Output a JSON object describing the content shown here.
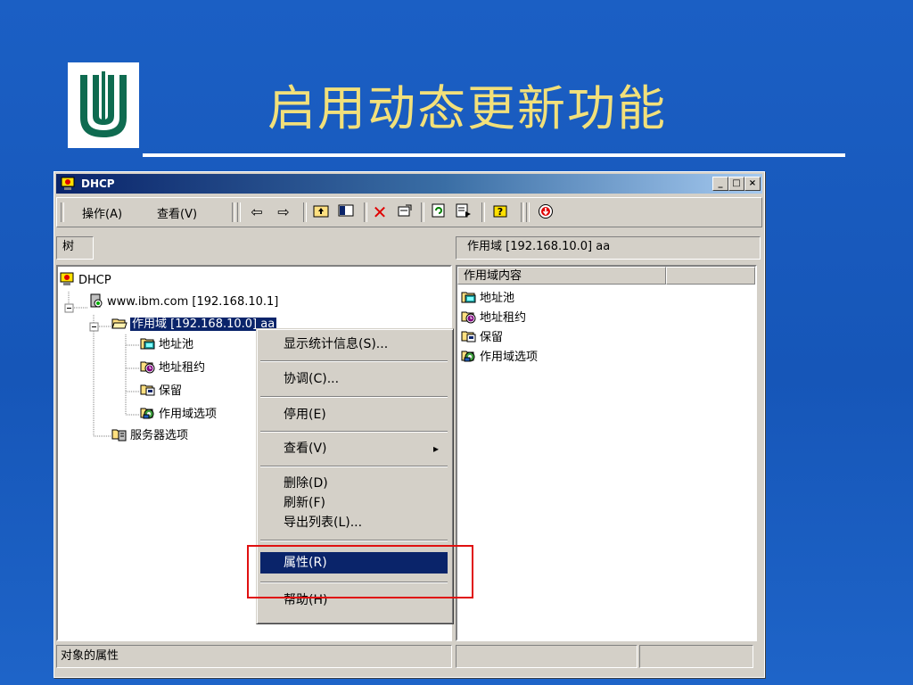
{
  "slide": {
    "title": "启用动态更新功能"
  },
  "window": {
    "title": "DHCP",
    "controls": {
      "minimize": "_",
      "maximize": "□",
      "close": "×"
    }
  },
  "toolbar": {
    "menus": [
      {
        "label": "操作(A)"
      },
      {
        "label": "查看(V)"
      }
    ]
  },
  "left_pane": {
    "header": "树",
    "tree": [
      {
        "label": "DHCP",
        "icon": "dhcp-console-icon"
      },
      {
        "label": "www.ibm.com [192.168.10.1]",
        "icon": "server-icon"
      },
      {
        "label": "作用域 [192.168.10.0] aa",
        "icon": "folder-open-icon",
        "selected": true
      },
      {
        "label": "地址池",
        "icon": "address-pool-icon"
      },
      {
        "label": "地址租约",
        "icon": "lease-clock-icon"
      },
      {
        "label": "保留",
        "icon": "reservation-icon"
      },
      {
        "label": "作用域选项",
        "icon": "scope-options-icon"
      },
      {
        "label": "服务器选项",
        "icon": "server-options-icon"
      }
    ]
  },
  "right_pane": {
    "header": "作用域 [192.168.10.0] aa",
    "column": "作用域内容",
    "items": [
      {
        "label": "地址池",
        "icon": "address-pool-icon"
      },
      {
        "label": "地址租约",
        "icon": "lease-clock-icon"
      },
      {
        "label": "保留",
        "icon": "reservation-icon"
      },
      {
        "label": "作用域选项",
        "icon": "scope-options-icon"
      }
    ]
  },
  "context_menu": {
    "items": [
      {
        "label": "显示统计信息(S)..."
      },
      {
        "label": "协调(C)..."
      },
      {
        "label": "停用(E)"
      },
      {
        "label": "查看(V)",
        "submenu": "▸"
      },
      {
        "label": "删除(D)"
      },
      {
        "label": "刷新(F)"
      },
      {
        "label": "导出列表(L)..."
      },
      {
        "label": "属性(R)",
        "selected": true
      },
      {
        "label": "帮助(H)"
      }
    ]
  },
  "status_bar": {
    "text": "对象的属性"
  },
  "colors": {
    "background": "#1b5fc4",
    "title_text": "#f2e07a",
    "selection": "#0a246a",
    "highlight_box": "#e01010"
  }
}
